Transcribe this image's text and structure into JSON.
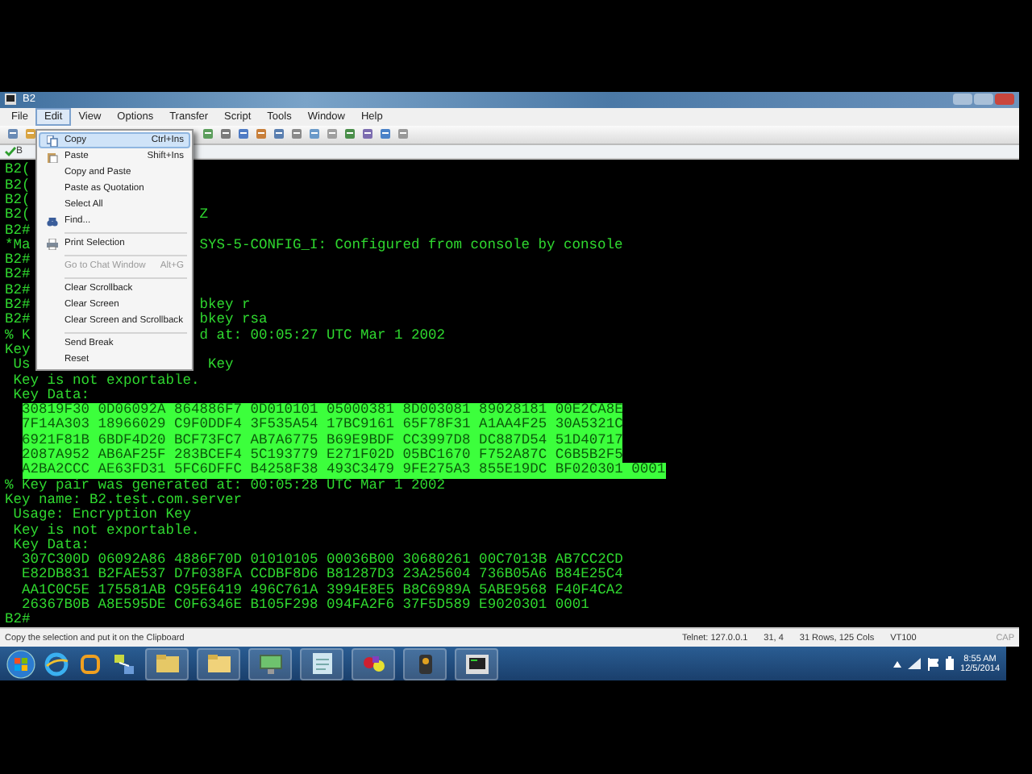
{
  "window": {
    "title": "B2"
  },
  "menu_bar": [
    {
      "label": "File",
      "selected": false
    },
    {
      "label": "Edit",
      "selected": true
    },
    {
      "label": "View",
      "selected": false
    },
    {
      "label": "Options",
      "selected": false
    },
    {
      "label": "Transfer",
      "selected": false
    },
    {
      "label": "Script",
      "selected": false
    },
    {
      "label": "Tools",
      "selected": false
    },
    {
      "label": "Window",
      "selected": false
    },
    {
      "label": "Help",
      "selected": false
    }
  ],
  "session_tab": {
    "label": "B",
    "connected": true
  },
  "edit_menu": [
    {
      "kind": "item",
      "label": "Copy",
      "shortcut": "Ctrl+Ins",
      "selected": true,
      "disabled": false
    },
    {
      "kind": "item",
      "label": "Paste",
      "shortcut": "Shift+Ins",
      "selected": false,
      "disabled": false
    },
    {
      "kind": "item",
      "label": "Copy and Paste",
      "selected": false,
      "disabled": false
    },
    {
      "kind": "item",
      "label": "Paste as Quotation",
      "selected": false,
      "disabled": false
    },
    {
      "kind": "item",
      "label": "Select All",
      "selected": false,
      "disabled": false
    },
    {
      "kind": "item",
      "label": "Find...",
      "selected": false,
      "disabled": false
    },
    {
      "kind": "separator"
    },
    {
      "kind": "item",
      "label": "Print Selection",
      "selected": false,
      "disabled": false
    },
    {
      "kind": "separator"
    },
    {
      "kind": "item",
      "label": "Go to Chat Window",
      "shortcut": "Alt+G",
      "selected": false,
      "disabled": true
    },
    {
      "kind": "separator"
    },
    {
      "kind": "item",
      "label": "Clear Scrollback",
      "selected": false,
      "disabled": false
    },
    {
      "kind": "item",
      "label": "Clear Screen",
      "selected": false,
      "disabled": false
    },
    {
      "kind": "item",
      "label": "Clear Screen and Scrollback",
      "selected": false,
      "disabled": false
    },
    {
      "kind": "separator"
    },
    {
      "kind": "item",
      "label": "Send Break",
      "selected": false,
      "disabled": false
    },
    {
      "kind": "item",
      "label": "Reset",
      "selected": false,
      "disabled": false
    }
  ],
  "terminal_lines": [
    {
      "text": "B2(",
      "selected": false
    },
    {
      "text": "B2(",
      "selected": false
    },
    {
      "text": "B2(",
      "selected": false
    },
    {
      "text": "B2(",
      "tail": "Z",
      "selected": false
    },
    {
      "text": "B2#",
      "selected": false
    },
    {
      "text": "*Ma",
      "tail": "SYS-5-CONFIG_I: Configured from console by console",
      "selected": false
    },
    {
      "text": "B2#",
      "selected": false
    },
    {
      "text": "B2#",
      "selected": false
    },
    {
      "text": "B2#",
      "selected": false
    },
    {
      "text": "B2#",
      "tail": "bkey r",
      "selected": false
    },
    {
      "text": "B2#",
      "tail": "bkey rsa",
      "selected": false
    },
    {
      "text": "% K",
      "tail": "d at: 00:05:27 UTC Mar 1 2002",
      "selected": false
    },
    {
      "text": "Key",
      "selected": false
    },
    {
      "text": " Us",
      "tail": " Key",
      "selected": false
    },
    {
      "text": " Key is not exportable.",
      "selected": false
    },
    {
      "text": " Key Data:",
      "selected": false
    },
    {
      "text": "  30819F30 0D06092A 864886F7 0D010101 05000381 8D003081 89028181 00E2CA8E",
      "selected": true
    },
    {
      "text": "  7F14A303 18966029 C9F0DDF4 3F535A54 17BC9161 65F78F31 A1AA4F25 30A5321C",
      "selected": true
    },
    {
      "text": "  6921F81B 6BDF4D20 BCF73FC7 AB7A6775 B69E9BDF CC3997D8 DC887D54 51D40717",
      "selected": true
    },
    {
      "text": "  2087A952 AB6AF25F 283BCEF4 5C193779 E271F02D 05BC1670 F752A87C C6B5B2F5",
      "selected": true
    },
    {
      "text": "  A2BA2CCC AE63FD31 5FC6DFFC B4258F38 493C3479 9FE275A3 855E19DC BF020301 0001",
      "selected": true
    },
    {
      "text": "% Key pair was generated at: 00:05:28 UTC Mar 1 2002",
      "selected": false
    },
    {
      "text": "Key name: B2.test.com.server",
      "selected": false
    },
    {
      "text": " Usage: Encryption Key",
      "selected": false
    },
    {
      "text": " Key is not exportable.",
      "selected": false
    },
    {
      "text": " Key Data:",
      "selected": false
    },
    {
      "text": "  307C300D 06092A86 4886F70D 01010105 00036B00 30680261 00C7013B AB7CC2CD",
      "selected": false
    },
    {
      "text": "  E82DB831 B2FAE537 D7F038FA CCDBF8D6 B81287D3 23A25604 736B05A6 B84E25C4",
      "selected": false
    },
    {
      "text": "  AA1C0C5E 175581AB C95E6419 496C761A 3994E8E5 B8C6989A 5ABE9568 F40F4CA2",
      "selected": false
    },
    {
      "text": "  26367B0B A8E595DE C0F6346E B105F298 094FA2F6 37F5D589 E9020301 0001",
      "selected": false
    },
    {
      "text": "B2#",
      "selected": false
    }
  ],
  "status_bar": {
    "message": "Copy the selection and put it on the Clipboard",
    "connection": "Telnet: 127.0.0.1",
    "cursor": "31,  4",
    "size": "31 Rows, 125 Cols",
    "emulation": "VT100",
    "indicator": "CAP"
  },
  "taskbar": {
    "time": "8:55 AM",
    "date": "12/5/2014"
  }
}
